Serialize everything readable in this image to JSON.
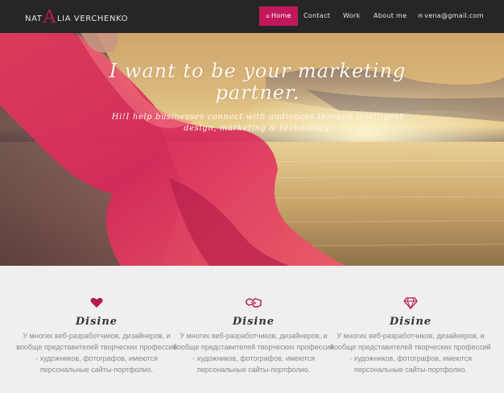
{
  "brand": {
    "pre": "NAT",
    "big": "A",
    "post": "LIA VERCHENKO"
  },
  "nav": {
    "home": "Home",
    "contact": "Contact",
    "work": "Work",
    "about": "About me",
    "email": "vena@gmail.com"
  },
  "colors": {
    "accent": "#c2185b",
    "navbar": "#262626",
    "features_bg": "#efefef"
  },
  "hero": {
    "title": "I want to be your marketing partner.",
    "subtitle": "Hi!I help businesses connect with audiences through intelligent design, marketing & technology."
  },
  "features": [
    {
      "icon": "heart-icon",
      "title": "Disine",
      "text": "У многих веб-разработчиков, дизайнеров, и вообще представителей творческих профессий - художников, фотографов, имеются персональные сайты-портфолио."
    },
    {
      "icon": "handshake-icon",
      "title": "Disine",
      "text": "У многих веб-разработчиков, дизайнеров, и вообще представителей творческих профессий - художников, фотографов, имеются персональные сайты-портфолио."
    },
    {
      "icon": "diamond-icon",
      "title": "Disine",
      "text": "У многих веб-разработчиков, дизайнеров, и вообще представителей творческих профессий - художников, фотографов, имеются персональные сайты-портфолио."
    }
  ]
}
